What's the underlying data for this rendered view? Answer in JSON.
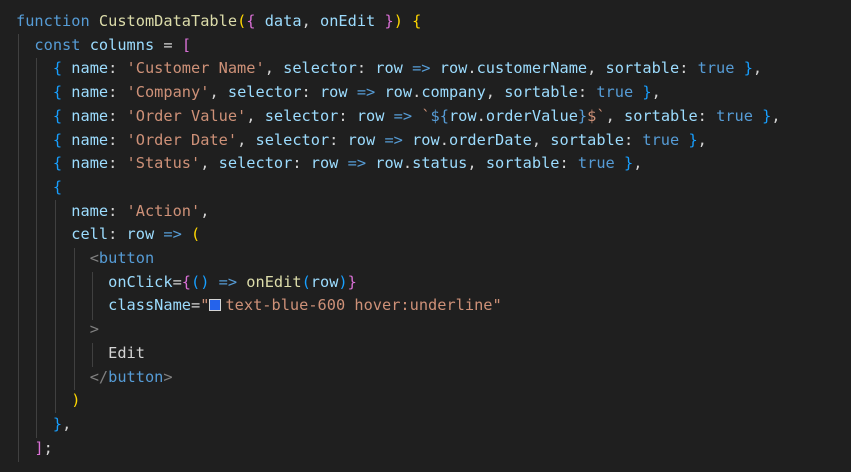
{
  "editor": {
    "colors": {
      "background": "#1f1f1f",
      "keyword": "#569cd6",
      "function": "#dcdcaa",
      "variable": "#9cdcfe",
      "string": "#ce9178",
      "bracket_gold": "#ffd700",
      "bracket_purple": "#da70d6",
      "bracket_blue": "#179fff",
      "swatch": "#2563eb"
    },
    "lines": [
      [
        [
          "kw",
          "function"
        ],
        [
          "op",
          " "
        ],
        [
          "fn",
          "CustomDataTable"
        ],
        [
          "b1",
          "("
        ],
        [
          "b2",
          "{"
        ],
        [
          "op",
          " "
        ],
        [
          "var",
          "data"
        ],
        [
          "op",
          ", "
        ],
        [
          "var",
          "onEdit"
        ],
        [
          "op",
          " "
        ],
        [
          "b2",
          "}"
        ],
        [
          "b1",
          ")"
        ],
        [
          "op",
          " "
        ],
        [
          "b1",
          "{"
        ]
      ],
      [
        [
          "op",
          "  "
        ],
        [
          "kw",
          "const"
        ],
        [
          "op",
          " "
        ],
        [
          "var",
          "columns"
        ],
        [
          "op",
          " = "
        ],
        [
          "b2",
          "["
        ]
      ],
      [
        [
          "op",
          "    "
        ],
        [
          "b3",
          "{"
        ],
        [
          "op",
          " "
        ],
        [
          "var",
          "name"
        ],
        [
          "op",
          ": "
        ],
        [
          "str",
          "'Customer Name'"
        ],
        [
          "op",
          ", "
        ],
        [
          "var",
          "selector"
        ],
        [
          "op",
          ": "
        ],
        [
          "var",
          "row"
        ],
        [
          "op",
          " "
        ],
        [
          "kw",
          "=>"
        ],
        [
          "op",
          " "
        ],
        [
          "var",
          "row"
        ],
        [
          "op",
          "."
        ],
        [
          "var",
          "customerName"
        ],
        [
          "op",
          ", "
        ],
        [
          "var",
          "sortable"
        ],
        [
          "op",
          ": "
        ],
        [
          "kw",
          "true"
        ],
        [
          "op",
          " "
        ],
        [
          "b3",
          "}"
        ],
        [
          "op",
          ","
        ]
      ],
      [
        [
          "op",
          "    "
        ],
        [
          "b3",
          "{"
        ],
        [
          "op",
          " "
        ],
        [
          "var",
          "name"
        ],
        [
          "op",
          ": "
        ],
        [
          "str",
          "'Company'"
        ],
        [
          "op",
          ", "
        ],
        [
          "var",
          "selector"
        ],
        [
          "op",
          ": "
        ],
        [
          "var",
          "row"
        ],
        [
          "op",
          " "
        ],
        [
          "kw",
          "=>"
        ],
        [
          "op",
          " "
        ],
        [
          "var",
          "row"
        ],
        [
          "op",
          "."
        ],
        [
          "var",
          "company"
        ],
        [
          "op",
          ", "
        ],
        [
          "var",
          "sortable"
        ],
        [
          "op",
          ": "
        ],
        [
          "kw",
          "true"
        ],
        [
          "op",
          " "
        ],
        [
          "b3",
          "}"
        ],
        [
          "op",
          ","
        ]
      ],
      [
        [
          "op",
          "    "
        ],
        [
          "b3",
          "{"
        ],
        [
          "op",
          " "
        ],
        [
          "var",
          "name"
        ],
        [
          "op",
          ": "
        ],
        [
          "str",
          "'Order Value'"
        ],
        [
          "op",
          ", "
        ],
        [
          "var",
          "selector"
        ],
        [
          "op",
          ": "
        ],
        [
          "var",
          "row"
        ],
        [
          "op",
          " "
        ],
        [
          "kw",
          "=>"
        ],
        [
          "op",
          " "
        ],
        [
          "str",
          "`"
        ],
        [
          "kw",
          "${"
        ],
        [
          "var",
          "row"
        ],
        [
          "op",
          "."
        ],
        [
          "var",
          "orderValue"
        ],
        [
          "kw",
          "}"
        ],
        [
          "str",
          "$`"
        ],
        [
          "op",
          ", "
        ],
        [
          "var",
          "sortable"
        ],
        [
          "op",
          ": "
        ],
        [
          "kw",
          "true"
        ],
        [
          "op",
          " "
        ],
        [
          "b3",
          "}"
        ],
        [
          "op",
          ","
        ]
      ],
      [
        [
          "op",
          "    "
        ],
        [
          "b3",
          "{"
        ],
        [
          "op",
          " "
        ],
        [
          "var",
          "name"
        ],
        [
          "op",
          ": "
        ],
        [
          "str",
          "'Order Date'"
        ],
        [
          "op",
          ", "
        ],
        [
          "var",
          "selector"
        ],
        [
          "op",
          ": "
        ],
        [
          "var",
          "row"
        ],
        [
          "op",
          " "
        ],
        [
          "kw",
          "=>"
        ],
        [
          "op",
          " "
        ],
        [
          "var",
          "row"
        ],
        [
          "op",
          "."
        ],
        [
          "var",
          "orderDate"
        ],
        [
          "op",
          ", "
        ],
        [
          "var",
          "sortable"
        ],
        [
          "op",
          ": "
        ],
        [
          "kw",
          "true"
        ],
        [
          "op",
          " "
        ],
        [
          "b3",
          "}"
        ],
        [
          "op",
          ","
        ]
      ],
      [
        [
          "op",
          "    "
        ],
        [
          "b3",
          "{"
        ],
        [
          "op",
          " "
        ],
        [
          "var",
          "name"
        ],
        [
          "op",
          ": "
        ],
        [
          "str",
          "'Status'"
        ],
        [
          "op",
          ", "
        ],
        [
          "var",
          "selector"
        ],
        [
          "op",
          ": "
        ],
        [
          "var",
          "row"
        ],
        [
          "op",
          " "
        ],
        [
          "kw",
          "=>"
        ],
        [
          "op",
          " "
        ],
        [
          "var",
          "row"
        ],
        [
          "op",
          "."
        ],
        [
          "var",
          "status"
        ],
        [
          "op",
          ", "
        ],
        [
          "var",
          "sortable"
        ],
        [
          "op",
          ": "
        ],
        [
          "kw",
          "true"
        ],
        [
          "op",
          " "
        ],
        [
          "b3",
          "}"
        ],
        [
          "op",
          ","
        ]
      ],
      [
        [
          "op",
          "    "
        ],
        [
          "b3",
          "{"
        ]
      ],
      [
        [
          "op",
          "      "
        ],
        [
          "var",
          "name"
        ],
        [
          "op",
          ": "
        ],
        [
          "str",
          "'Action'"
        ],
        [
          "op",
          ","
        ]
      ],
      [
        [
          "op",
          "      "
        ],
        [
          "var",
          "cell"
        ],
        [
          "op",
          ": "
        ],
        [
          "var",
          "row"
        ],
        [
          "op",
          " "
        ],
        [
          "kw",
          "=>"
        ],
        [
          "op",
          " "
        ],
        [
          "b1",
          "("
        ]
      ],
      [
        [
          "op",
          "        "
        ],
        [
          "tag",
          "<"
        ],
        [
          "tagname",
          "button"
        ]
      ],
      [
        [
          "op",
          "          "
        ],
        [
          "attr",
          "onClick"
        ],
        [
          "op",
          "="
        ],
        [
          "b2",
          "{"
        ],
        [
          "b3",
          "()"
        ],
        [
          "op",
          " "
        ],
        [
          "kw",
          "=>"
        ],
        [
          "op",
          " "
        ],
        [
          "fn",
          "onEdit"
        ],
        [
          "b3",
          "("
        ],
        [
          "var",
          "row"
        ],
        [
          "b3",
          ")"
        ],
        [
          "b2",
          "}"
        ]
      ],
      [
        [
          "op",
          "          "
        ],
        [
          "attr",
          "className"
        ],
        [
          "op",
          "="
        ],
        [
          "str",
          "\""
        ],
        [
          "swatch",
          ""
        ],
        [
          "str",
          "text-blue-600 hover:underline\""
        ]
      ],
      [
        [
          "op",
          "        "
        ],
        [
          "tag",
          ">"
        ]
      ],
      [
        [
          "op",
          "          "
        ],
        [
          "txt",
          "Edit"
        ]
      ],
      [
        [
          "op",
          "        "
        ],
        [
          "tag",
          "</"
        ],
        [
          "tagname",
          "button"
        ],
        [
          "tag",
          ">"
        ]
      ],
      [
        [
          "op",
          "      "
        ],
        [
          "b1",
          ")"
        ]
      ],
      [
        [
          "op",
          "    "
        ],
        [
          "b3",
          "}"
        ],
        [
          "op",
          ","
        ]
      ],
      [
        [
          "op",
          "  "
        ],
        [
          "b2",
          "]"
        ],
        [
          "op",
          ";"
        ]
      ]
    ]
  }
}
